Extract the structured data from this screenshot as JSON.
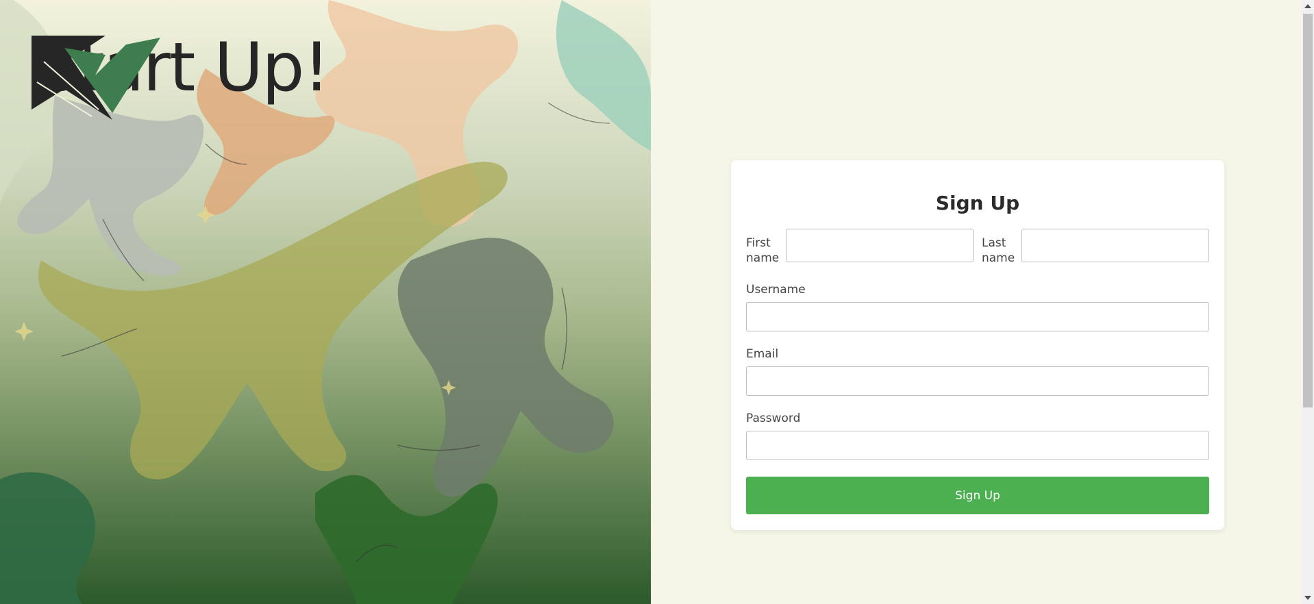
{
  "brand": {
    "name": "Start Up!",
    "logo_icon": "checkmark-logo-icon"
  },
  "form": {
    "title": "Sign Up",
    "first_name_label": "First name",
    "last_name_label": "Last name",
    "username_label": "Username",
    "email_label": "Email",
    "password_label": "Password",
    "submit_label": "Sign Up"
  },
  "colors": {
    "accent": "#4caf50",
    "background": "#f5f6e8"
  }
}
